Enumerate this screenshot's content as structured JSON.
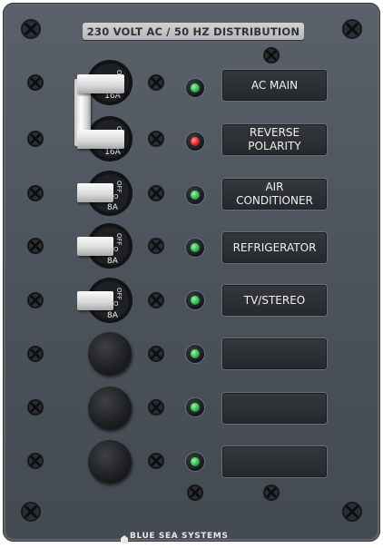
{
  "panel": {
    "title": "230 VOLT AC / 50 HZ DISTRIBUTION",
    "brand": "BLUE SEA SYSTEMS"
  },
  "circuits": [
    {
      "label": "AC MAIN",
      "breaker_rating": "16A",
      "breaker_marking": "OFF O",
      "indicator": "green",
      "state": "on"
    },
    {
      "label": "REVERSE\nPOLARITY",
      "breaker_rating": "16A",
      "breaker_marking": "OFF O",
      "indicator": "red",
      "state": "on"
    },
    {
      "label": "AIR\nCONDITIONER",
      "breaker_rating": "8A",
      "breaker_marking": "OFF O",
      "indicator": "green",
      "state": "on"
    },
    {
      "label": "REFRIGERATOR",
      "breaker_rating": "8A",
      "breaker_marking": "OFF O",
      "indicator": "green",
      "state": "on"
    },
    {
      "label": "TV/STEREO",
      "breaker_rating": "8A",
      "breaker_marking": "OFF O",
      "indicator": "green",
      "state": "on"
    },
    {
      "label": "",
      "breaker_rating": "",
      "indicator": "green",
      "state": "blank"
    },
    {
      "label": "",
      "breaker_rating": "",
      "indicator": "green",
      "state": "blank"
    },
    {
      "label": "",
      "breaker_rating": "",
      "indicator": "green",
      "state": "blank"
    }
  ],
  "colors": {
    "led_green": "#2fb84a",
    "led_red": "#e02020",
    "panel": "#4e555e",
    "label_plate": "#2b2e33"
  },
  "icons": {
    "screw": "phillips-screw-icon",
    "brand_logo": "blue-sea-logo-icon"
  }
}
